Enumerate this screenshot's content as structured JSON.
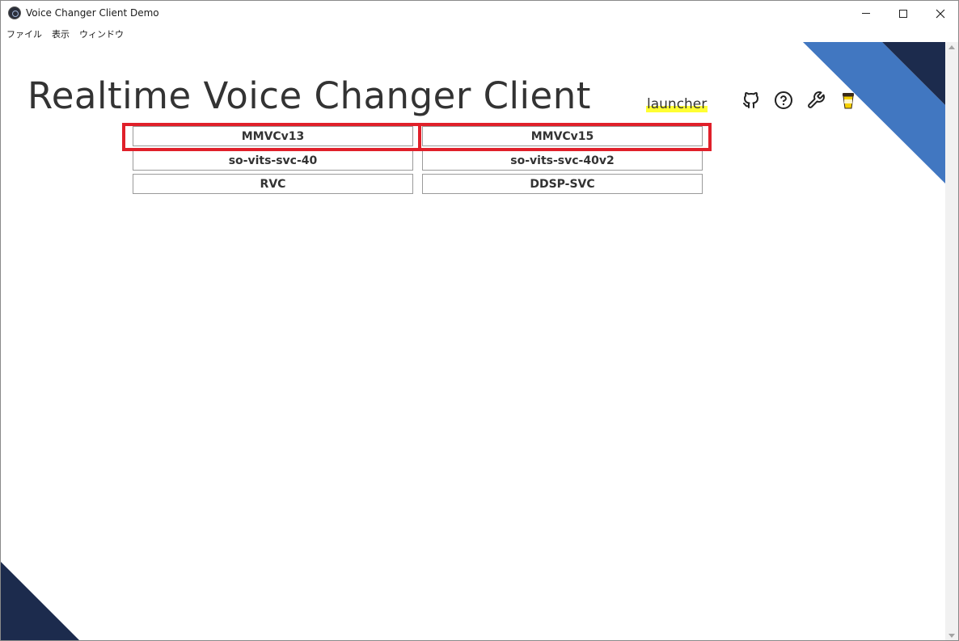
{
  "window": {
    "title": "Voice Changer Client Demo",
    "controls": {
      "minimize": "minimize",
      "maximize": "maximize",
      "close": "close"
    }
  },
  "menu": {
    "items": [
      "ファイル",
      "表示",
      "ウィンドウ"
    ]
  },
  "header": {
    "title": "Realtime Voice Changer Client",
    "subtitle": "launcher",
    "icons": [
      "github-icon",
      "help-icon",
      "wrench-icon",
      "coffee-icon"
    ]
  },
  "models": {
    "buttons": [
      "MMVCv13",
      "MMVCv15",
      "so-vits-svc-40",
      "so-vits-svc-40v2",
      "RVC",
      "DDSP-SVC"
    ],
    "highlighted": [
      "MMVCv13",
      "MMVCv15"
    ]
  },
  "colors": {
    "accent_blue": "#4177c1",
    "dark_navy": "#1c2b4d",
    "highlight_red": "#e0202a",
    "underline_yellow": "#ffff33"
  }
}
